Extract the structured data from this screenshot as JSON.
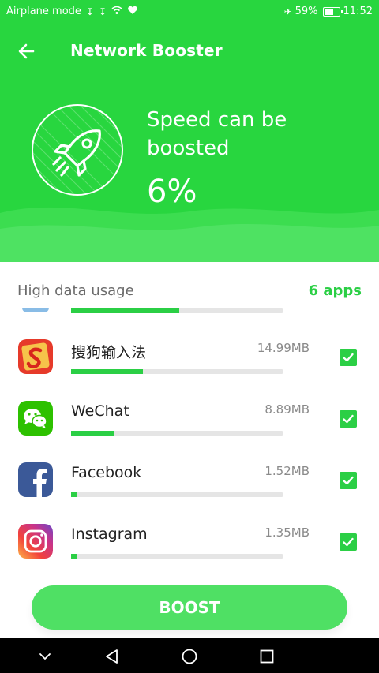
{
  "status_bar": {
    "carrier": "Airplane mode",
    "battery": "59%",
    "time": "11:52",
    "icons": [
      "usb-icon",
      "usb-icon",
      "wifi-icon",
      "heart-rate-icon",
      "airplane-icon",
      "battery-icon"
    ]
  },
  "toolbar": {
    "title": "Network Booster",
    "back_icon": "arrow-left-icon"
  },
  "hero": {
    "icon": "rocket-icon",
    "headline": "Speed can be boosted",
    "percent": "6%"
  },
  "section": {
    "title": "High data usage",
    "count": "6 apps"
  },
  "partial_row": {
    "progress": 0.51
  },
  "apps": [
    {
      "name": "搜狗输入法",
      "size": "14.99MB",
      "icon": "sogou-input-icon",
      "progress": 0.34,
      "checked": true
    },
    {
      "name": "WeChat",
      "size": "8.89MB",
      "icon": "wechat-icon",
      "progress": 0.2,
      "checked": true
    },
    {
      "name": "Facebook",
      "size": "1.52MB",
      "icon": "facebook-icon",
      "progress": 0.03,
      "checked": true
    },
    {
      "name": "Instagram",
      "size": "1.35MB",
      "icon": "instagram-icon",
      "progress": 0.03,
      "checked": true
    }
  ],
  "boost_button": {
    "label": "BOOST"
  },
  "nav": {
    "icons": [
      "chevron-down-icon",
      "back-triangle-icon",
      "home-circle-icon",
      "recents-square-icon"
    ]
  },
  "colors": {
    "primary": "#28d63f",
    "accent": "#2bcf45",
    "button": "#4fe064"
  }
}
